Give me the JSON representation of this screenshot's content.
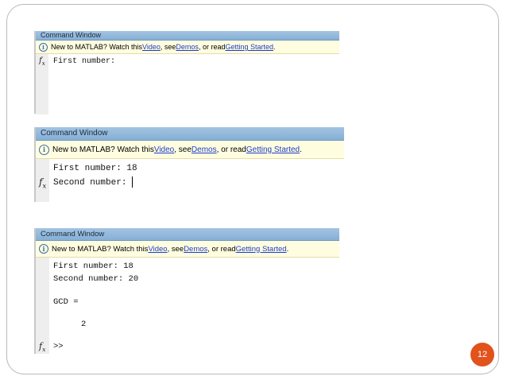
{
  "panels": [
    {
      "title": "Command Window",
      "info": {
        "prefix": "New to MATLAB? Watch this ",
        "video": "Video",
        "sep1": ", see ",
        "demos": "Demos",
        "sep2": ", or read ",
        "getting_started": "Getting Started",
        "suffix": "."
      },
      "lines": [
        "First number:"
      ]
    },
    {
      "title": "Command Window",
      "info": {
        "prefix": "New to MATLAB? Watch this ",
        "video": "Video",
        "sep1": ", see ",
        "demos": "Demos",
        "sep2": ", or read ",
        "getting_started": "Getting Started",
        "suffix": "."
      },
      "lines": [
        "First number: 18",
        "Second number: "
      ]
    },
    {
      "title": "Command Window",
      "info": {
        "prefix": "New to MATLAB? Watch this ",
        "video": "Video",
        "sep1": ", see ",
        "demos": "Demos",
        "sep2": ", or read ",
        "getting_started": "Getting Started",
        "suffix": "."
      },
      "lines": [
        "First number: 18",
        "Second number: 20",
        "GCD =",
        "2",
        ">>"
      ]
    }
  ],
  "slide": {
    "page_number": "12"
  }
}
